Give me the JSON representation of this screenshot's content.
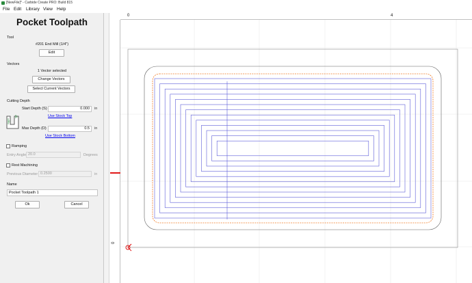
{
  "window": {
    "title": "[NewFile]* - Carbide Create PRO: Build 815"
  },
  "menu": {
    "file": "File",
    "edit": "Edit",
    "library": "Library",
    "view": "View",
    "help": "Help"
  },
  "panel": {
    "title": "Pocket Toolpath",
    "tool": {
      "section": "Tool",
      "name": "#201 End Mill (1/4\")",
      "edit_label": "Edit"
    },
    "vectors": {
      "section": "Vectors",
      "status": "1 Vector selected",
      "change_label": "Change Vectors",
      "select_current_label": "Select Current Vectors"
    },
    "cutting_depth": {
      "section": "Cutting Depth",
      "start_depth_label": "Start Depth (S)",
      "start_depth_value": "0.000",
      "start_unit": "in",
      "use_stock_top": "Use Stock Top",
      "max_depth_label": "Max Depth (D)",
      "max_depth_value": "0.5",
      "max_unit": "in",
      "use_stock_bottom": "Use Stock Bottom",
      "diagram_icon": "depth-diagram-icon"
    },
    "ramping": {
      "label": "Ramping",
      "checked": false,
      "entry_angle_label": "Entry Angle",
      "entry_angle_value": "20.0",
      "entry_angle_unit": "Degrees"
    },
    "rest_machining": {
      "label": "Rest Machining",
      "checked": false,
      "previous_diameter_label": "Previous Diameter",
      "previous_diameter_value": "0.2500",
      "previous_diameter_unit": "in"
    },
    "name": {
      "section": "Name",
      "value": "Pocket Toolpath 1"
    },
    "ok_label": "Ok",
    "cancel_label": "Cancel"
  },
  "canvas": {
    "ruler_top_labels": [
      "0",
      "4"
    ],
    "ruler_left_labels": [
      "0"
    ],
    "colors": {
      "toolpath": "#5a5ad8",
      "offset": "#f07820",
      "outline": "#606060",
      "origin": "#e01818"
    },
    "icons": {
      "origin": "origin-marker-icon",
      "app": "carbide-create-app-icon"
    }
  }
}
